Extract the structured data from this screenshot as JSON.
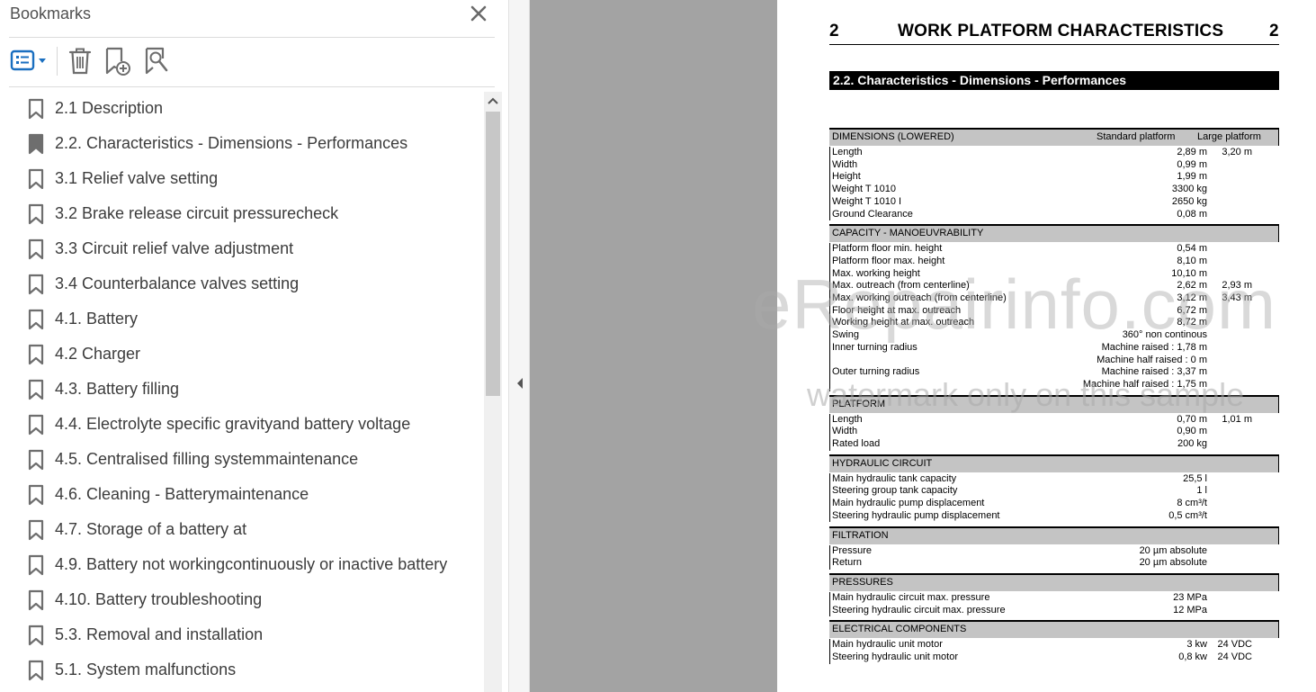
{
  "bookmarks_panel": {
    "title": "Bookmarks",
    "items": [
      {
        "label": "2.1 Description",
        "selected": false
      },
      {
        "label": "2.2. Characteristics - Dimensions - Performances",
        "selected": true
      },
      {
        "label": "3.1 Relief valve setting",
        "selected": false
      },
      {
        "label": "3.2 Brake release circuit pressurecheck",
        "selected": false
      },
      {
        "label": "3.3 Circuit relief valve adjustment",
        "selected": false
      },
      {
        "label": "3.4 Counterbalance valves setting",
        "selected": false
      },
      {
        "label": "4.1. Battery",
        "selected": false
      },
      {
        "label": "4.2 Charger",
        "selected": false
      },
      {
        "label": "4.3. Battery filling",
        "selected": false
      },
      {
        "label": "4.4. Electrolyte specific gravityand battery voltage",
        "selected": false
      },
      {
        "label": "4.5. Centralised filling systemmaintenance",
        "selected": false
      },
      {
        "label": "4.6. Cleaning - Batterymaintenance",
        "selected": false
      },
      {
        "label": "4.7. Storage of a battery at",
        "selected": false
      },
      {
        "label": "4.9. Battery not workingcontinuously or inactive battery",
        "selected": false
      },
      {
        "label": "4.10. Battery troubleshooting",
        "selected": false
      },
      {
        "label": "5.3. Removal and installation",
        "selected": false
      },
      {
        "label": "5.1. System malfunctions",
        "selected": false
      }
    ],
    "toolbar": {
      "icons": [
        "options-list-icon",
        "delete-bookmark-icon",
        "add-bookmark-icon",
        "find-bookmark-icon"
      ]
    },
    "colors": {
      "accent": "#1a6fc0",
      "icon": "#6e6e6e"
    }
  },
  "document": {
    "chapter_number_left": "2",
    "chapter_title": "WORK PLATFORM CHARACTERISTICS",
    "chapter_number_right": "2",
    "section_title": "2.2. Characteristics - Dimensions - Performances",
    "sections": [
      {
        "title": "DIMENSIONS (LOWERED)",
        "col1": "Standard platform",
        "col2": "Large platform",
        "rows": [
          {
            "label": "Length",
            "v1": "2,89 m",
            "v2": "3,20 m"
          },
          {
            "label": "Width",
            "v1": "0,99 m",
            "v2": ""
          },
          {
            "label": "Height",
            "v1": "1,99 m",
            "v2": ""
          },
          {
            "label": "Weight T 1010",
            "v1": "3300 kg",
            "v2": ""
          },
          {
            "label": "Weight T 1010 I",
            "v1": "2650 kg",
            "v2": ""
          },
          {
            "label": "Ground Clearance",
            "v1": "0,08 m",
            "v2": ""
          }
        ]
      },
      {
        "title": "CAPACITY - MANOEUVRABILITY",
        "col1": "",
        "col2": "",
        "rows": [
          {
            "label": "Platform floor min. height",
            "v1": "0,54 m",
            "v2": ""
          },
          {
            "label": "Platform floor max. height",
            "v1": "8,10 m",
            "v2": ""
          },
          {
            "label": "Max. working height",
            "v1": "10,10 m",
            "v2": ""
          },
          {
            "label": "Max. outreach (from centerline)",
            "v1": "2,62 m",
            "v2": "2,93 m"
          },
          {
            "label": "Max. working outreach (from centerline)",
            "v1": "3,12 m",
            "v2": "3,43 m"
          },
          {
            "label": "Floor height at max. outreach",
            "v1": "6,72 m",
            "v2": ""
          },
          {
            "label": "Working height at max. outreach",
            "v1": "8,72 m",
            "v2": ""
          },
          {
            "label": "Swing",
            "v1": "360° non continous",
            "v2": ""
          },
          {
            "label": "Inner turning radius",
            "v1": "Machine raised : 1,78 m",
            "v2": ""
          },
          {
            "label": "",
            "v1": "Machine half raised : 0 m",
            "v2": ""
          },
          {
            "label": "Outer turning radius",
            "v1": "Machine raised : 3,37 m",
            "v2": ""
          },
          {
            "label": "",
            "v1": "Machine half raised : 1,75 m",
            "v2": ""
          }
        ]
      },
      {
        "title": "PLATFORM",
        "col1": "",
        "col2": "",
        "rows": [
          {
            "label": "Length",
            "v1": "0,70 m",
            "v2": "1,01 m"
          },
          {
            "label": "Width",
            "v1": "0,90 m",
            "v2": ""
          },
          {
            "label": "Rated load",
            "v1": "200 kg",
            "v2": ""
          }
        ]
      },
      {
        "title": "HYDRAULIC CIRCUIT",
        "col1": "",
        "col2": "",
        "rows": [
          {
            "label": "Main hydraulic tank capacity",
            "v1": "25,5 l",
            "v2": ""
          },
          {
            "label": "Steering group tank capacity",
            "v1": "1 l",
            "v2": ""
          },
          {
            "label": "Main hydraulic pump displacement",
            "v1": "8 cm³/t",
            "v2": ""
          },
          {
            "label": "Steering hydraulic pump displacement",
            "v1": "0,5 cm³/t",
            "v2": ""
          }
        ]
      },
      {
        "title": "FILTRATION",
        "col1": "",
        "col2": "",
        "rows": [
          {
            "label": "Pressure",
            "v1": "20 µm absolute",
            "v2": ""
          },
          {
            "label": "Return",
            "v1": "20 µm absolute",
            "v2": ""
          }
        ]
      },
      {
        "title": "PRESSURES",
        "col1": "",
        "col2": "",
        "rows": [
          {
            "label": "Main hydraulic circuit max. pressure",
            "v1": "23 MPa",
            "v2": ""
          },
          {
            "label": "Steering hydraulic circuit max. pressure",
            "v1": "12 MPa",
            "v2": ""
          }
        ]
      },
      {
        "title": "ELECTRICAL COMPONENTS",
        "col1": "",
        "col2": "",
        "rows": [
          {
            "label": "Main hydraulic unit motor",
            "v1": "3 kw",
            "v2": "24 VDC"
          },
          {
            "label": "Steering hydraulic unit motor",
            "v1": "0,8 kw",
            "v2": "24 VDC"
          }
        ]
      }
    ]
  },
  "watermark": {
    "main": "eRepairinfo.com",
    "sub": "watermark only on this sample"
  }
}
